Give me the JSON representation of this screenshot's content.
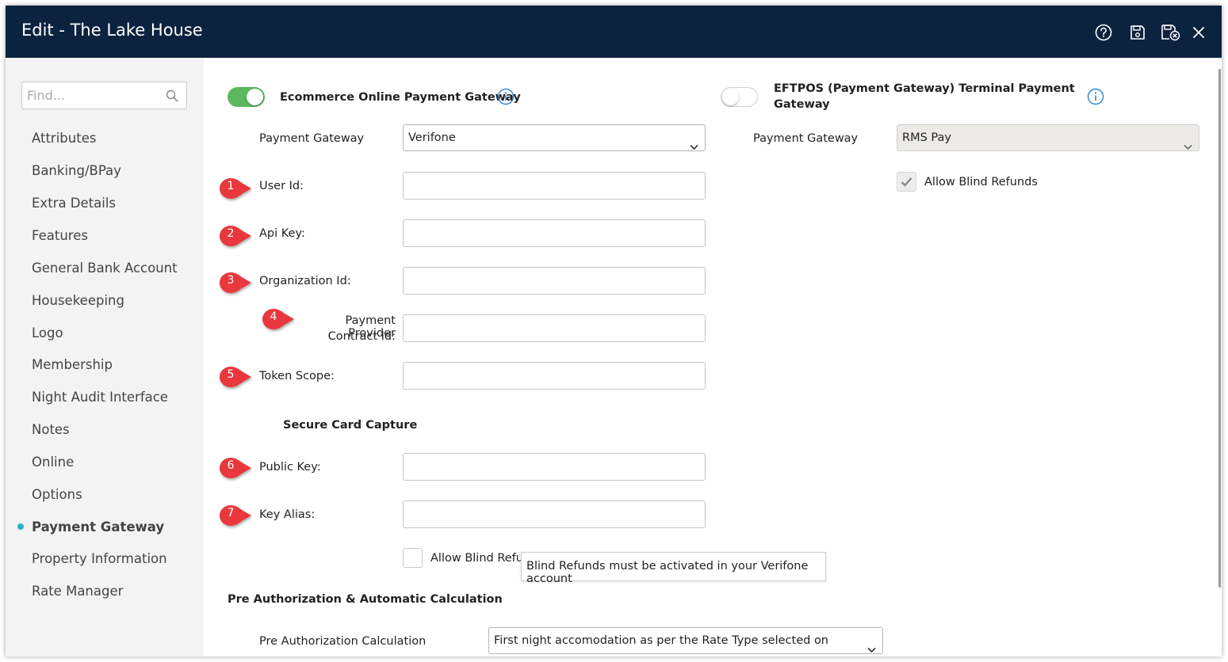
{
  "window": {
    "title": "Edit - The Lake House"
  },
  "titlebar_icons": [
    "help-icon",
    "save-icon",
    "save-close-icon",
    "close-icon"
  ],
  "sidebar": {
    "search_placeholder": "Find...",
    "items": [
      {
        "label": "Attributes"
      },
      {
        "label": "Banking/BPay"
      },
      {
        "label": "Extra Details"
      },
      {
        "label": "Features"
      },
      {
        "label": "General Bank Account"
      },
      {
        "label": "Housekeeping"
      },
      {
        "label": "Logo"
      },
      {
        "label": "Membership"
      },
      {
        "label": "Night Audit Interface"
      },
      {
        "label": "Notes"
      },
      {
        "label": "Online"
      },
      {
        "label": "Options"
      },
      {
        "label": "Payment Gateway",
        "active": true
      },
      {
        "label": "Property Information"
      },
      {
        "label": "Rate Manager"
      }
    ]
  },
  "ecommerce": {
    "toggle_label": "Ecommerce Online Payment Gateway",
    "toggle_on": true,
    "gateway_label": "Payment Gateway",
    "gateway_value": "Verifone",
    "fields": [
      {
        "marker": "1",
        "label": "User Id:",
        "value": ""
      },
      {
        "marker": "2",
        "label": "Api Key:",
        "value": ""
      },
      {
        "marker": "3",
        "label": "Organization Id:",
        "value": ""
      },
      {
        "marker": "4",
        "label_line1": "Payment Provider",
        "label_line2": "Contract Id:",
        "value": ""
      },
      {
        "marker": "5",
        "label": "Token Scope:",
        "value": ""
      }
    ],
    "secure_heading": "Secure Card Capture",
    "secure_fields": [
      {
        "marker": "6",
        "label": "Public Key:",
        "value": ""
      },
      {
        "marker": "7",
        "label": "Key Alias:",
        "value": ""
      }
    ],
    "blind_refunds_label": "Allow Blind Refun",
    "blind_refunds_checked": false,
    "tooltip": "Blind Refunds must be activated in your Verifone account"
  },
  "eftpos": {
    "toggle_label_line1": "EFTPOS (Payment Gateway) Terminal Payment",
    "toggle_label_line2": "Gateway",
    "toggle_on": false,
    "gateway_label": "Payment Gateway",
    "gateway_value": "RMS Pay",
    "blind_refunds_label": "Allow Blind Refunds",
    "blind_refunds_checked": true
  },
  "preauth": {
    "heading": "Pre Authorization & Automatic Calculation",
    "calc_label": "Pre Authorization Calculation",
    "calc_value": "First night accomodation as per the Rate Type selected on Reservation"
  },
  "colors": {
    "titlebar": "#0c2340",
    "toggle_on": "#5cb85c",
    "marker": "#e8373c",
    "active_dot": "#24b3c7",
    "info": "#2f86d1"
  }
}
